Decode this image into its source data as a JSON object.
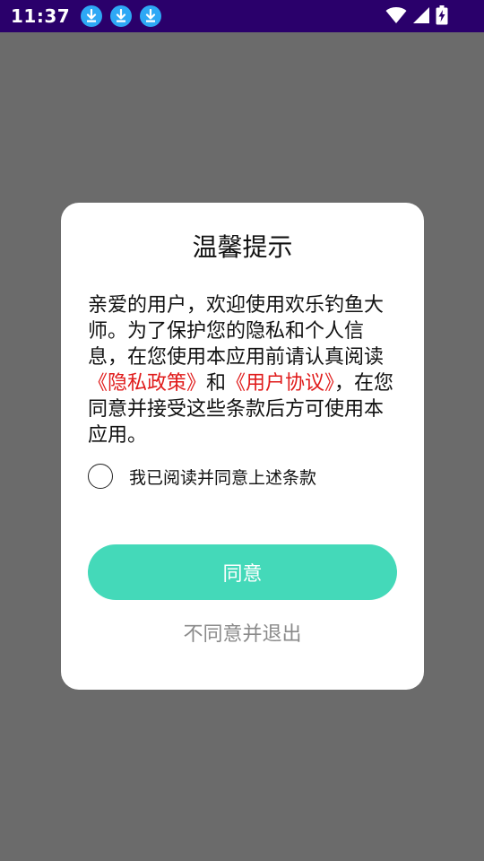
{
  "status_bar": {
    "time": "11:37",
    "notification_icons": [
      "download-icon",
      "download-icon",
      "download-icon"
    ],
    "system_icons": [
      "wifi-icon",
      "signal-icon",
      "battery-charging-icon"
    ]
  },
  "dialog": {
    "title": "温馨提示",
    "body_intro": "亲爱的用户，欢迎使用欢乐钓鱼大师。为了保护您的隐私和个人信息，在您使用本应用前请认真阅读",
    "privacy_link": "《隐私政策》",
    "body_and": "和",
    "agreement_link": "《用户协议》",
    "body_outro": "，在您同意并接受这些条款后方可使用本应用。",
    "checkbox_label": "我已阅读并同意上述条款",
    "checkbox_checked": false,
    "agree_button": "同意",
    "exit_button": "不同意并退出"
  },
  "colors": {
    "status_bar": "#2a006b",
    "scrim": "#6b6b6b",
    "accent": "#44d9b9",
    "link": "#e01b1b",
    "secondary_text": "#8a8a8a"
  }
}
